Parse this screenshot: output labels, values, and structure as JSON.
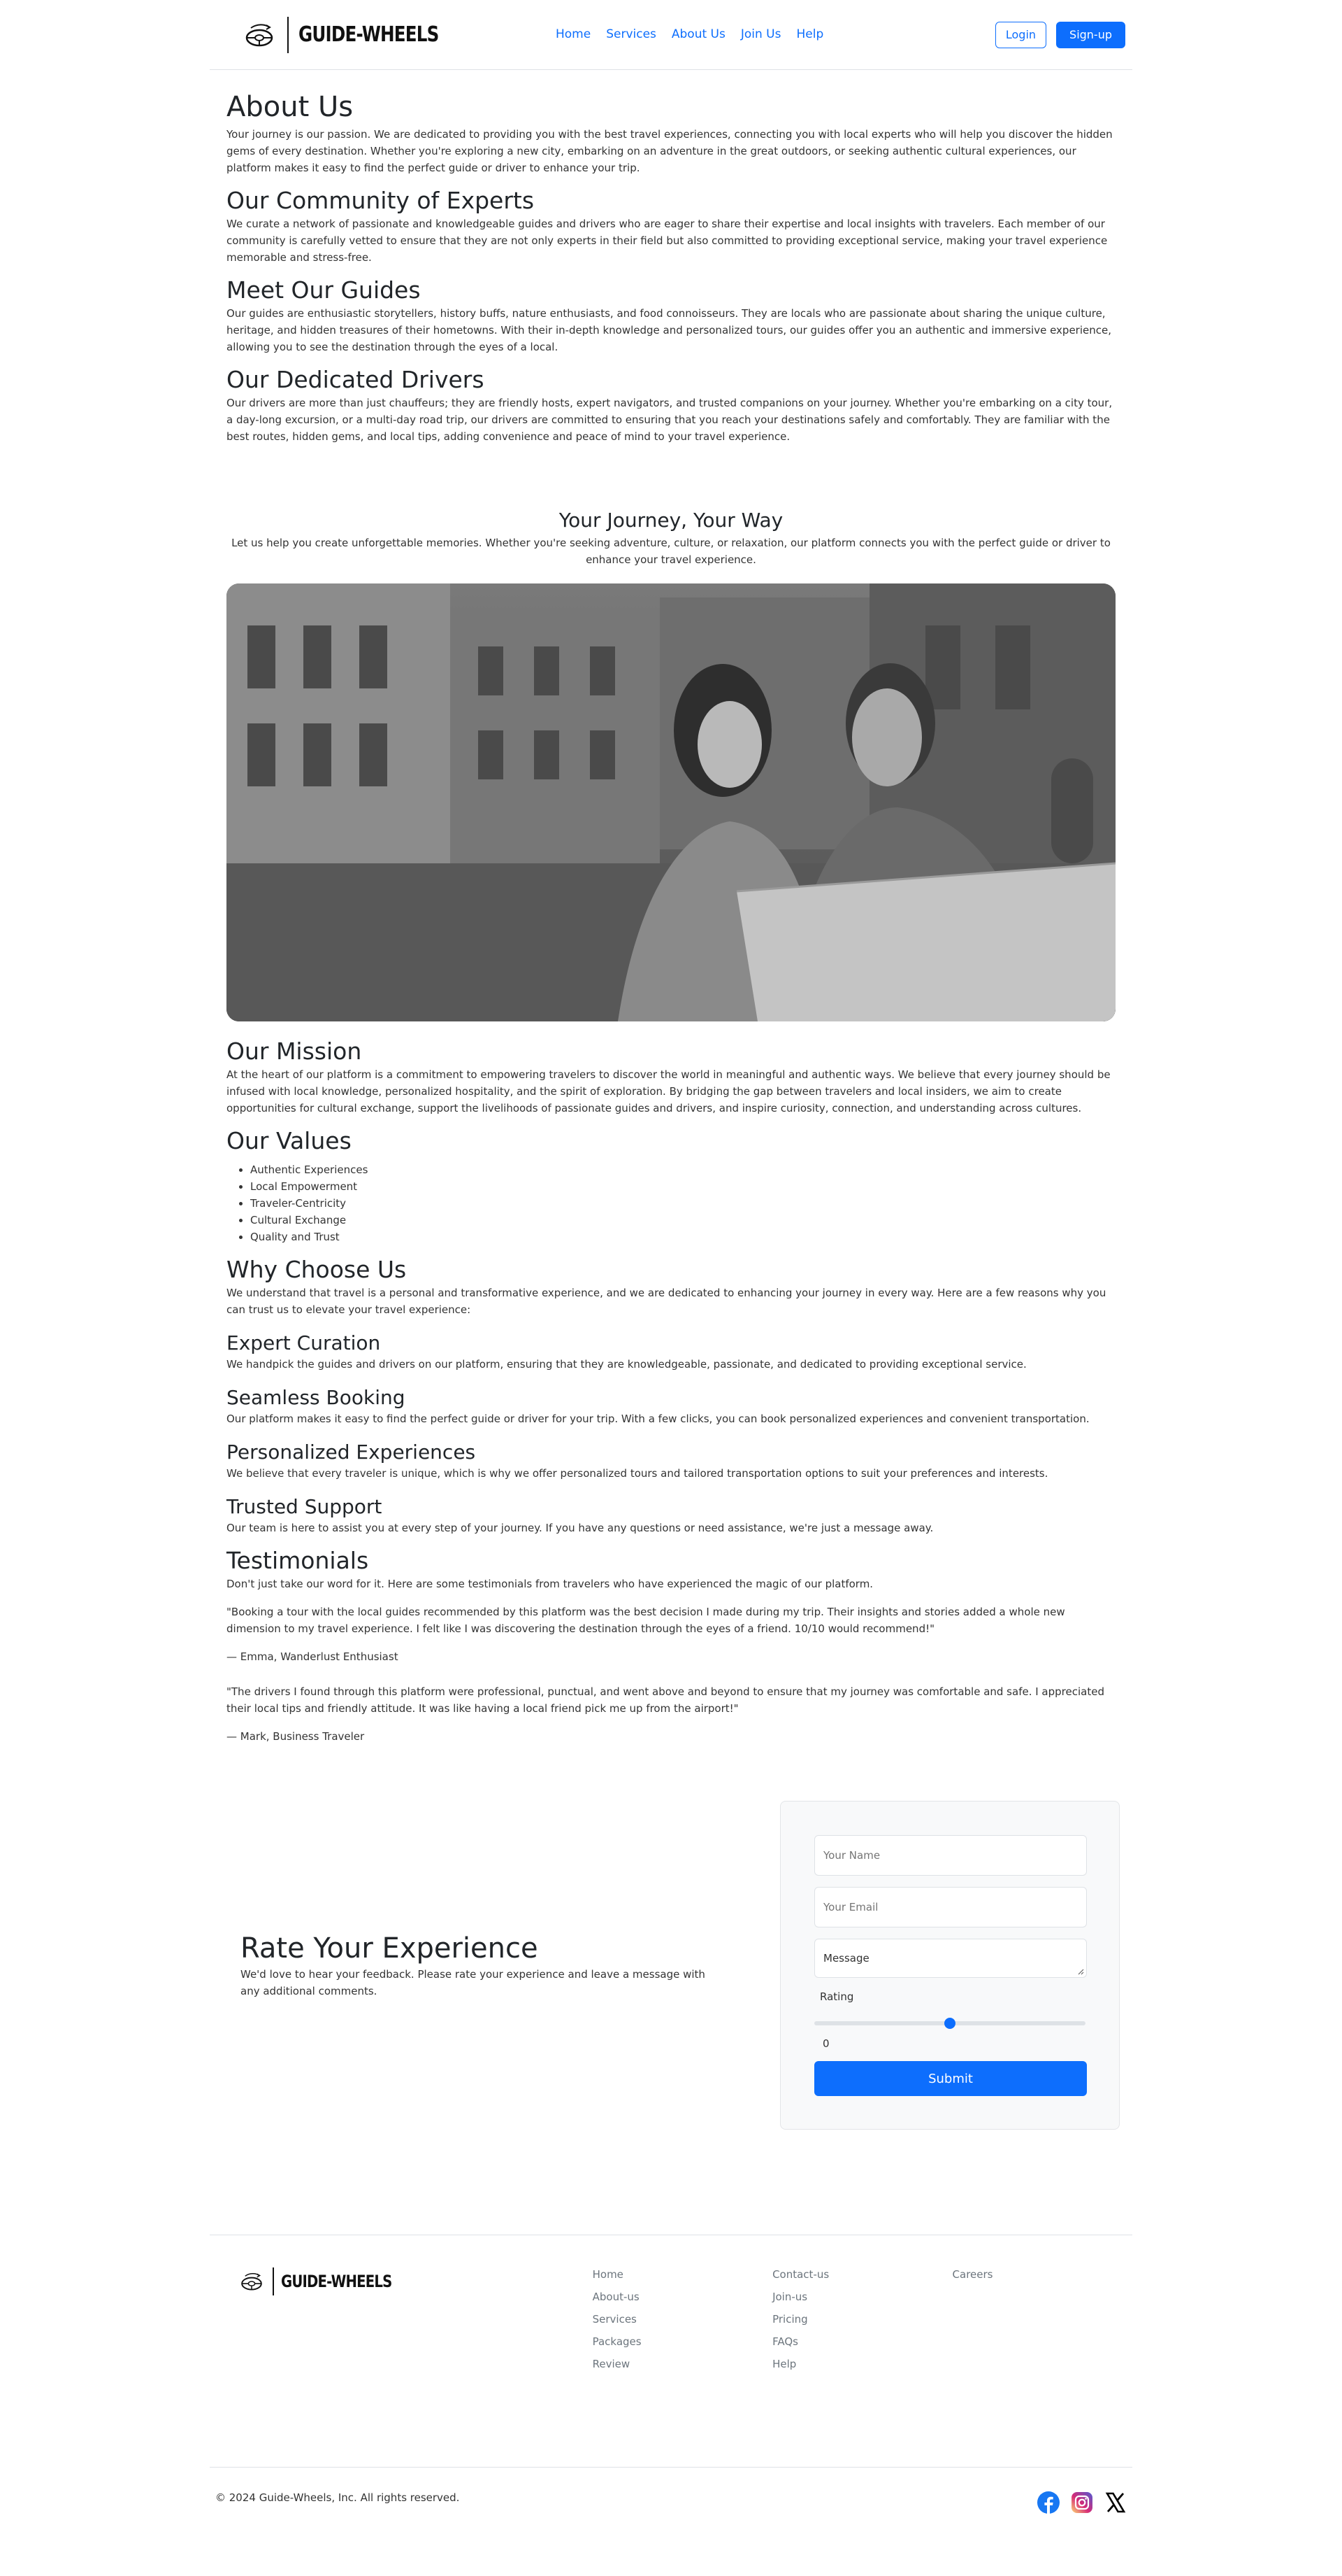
{
  "header": {
    "brand": "GUIDE-WHEELS",
    "nav": [
      "Home",
      "Services",
      "About Us",
      "Join Us",
      "Help"
    ],
    "login": "Login",
    "signup": "Sign-up"
  },
  "about": {
    "title": "About Us",
    "intro": "Your journey is our passion. We are dedicated to providing you with the best travel experiences, connecting you with local experts who will help you discover the hidden gems of every destination. Whether you're exploring a new city, embarking on an adventure in the great outdoors, or seeking authentic cultural experiences, our platform makes it easy to find the perfect guide or driver to enhance your trip.",
    "community_title": "Our Community of Experts",
    "community_text": "We curate a network of passionate and knowledgeable guides and drivers who are eager to share their expertise and local insights with travelers. Each member of our community is carefully vetted to ensure that they are not only experts in their field but also committed to providing exceptional service, making your travel experience memorable and stress-free.",
    "guides_title": "Meet Our Guides",
    "guides_text": "Our guides are enthusiastic storytellers, history buffs, nature enthusiasts, and food connoisseurs. They are locals who are passionate about sharing the unique culture, heritage, and hidden treasures of their hometowns. With their in-depth knowledge and personalized tours, our guides offer you an authentic and immersive experience, allowing you to see the destination through the eyes of a local.",
    "drivers_title": "Our Dedicated Drivers",
    "drivers_text": "Our drivers are more than just chauffeurs; they are friendly hosts, expert navigators, and trusted companions on your journey. Whether you're embarking on a city tour, a day-long excursion, or a multi-day road trip, our drivers are committed to ensuring that you reach your destinations safely and comfortably. They are familiar with the best routes, hidden gems, and local tips, adding convenience and peace of mind to your travel experience."
  },
  "journey": {
    "title": "Your Journey, Your Way",
    "text": "Let us help you create unforgettable memories. Whether you're seeking adventure, culture, or relaxation, our platform connects you with the perfect guide or driver to enhance your travel experience."
  },
  "mission": {
    "title": "Our Mission",
    "text": "At the heart of our platform is a commitment to empowering travelers to discover the world in meaningful and authentic ways. We believe that every journey should be infused with local knowledge, personalized hospitality, and the spirit of exploration. By bridging the gap between travelers and local insiders, we aim to create opportunities for cultural exchange, support the livelihoods of passionate guides and drivers, and inspire curiosity, connection, and understanding across cultures."
  },
  "values": {
    "title": "Our Values",
    "items": [
      "Authentic Experiences",
      "Local Empowerment",
      "Traveler-Centricity",
      "Cultural Exchange",
      "Quality and Trust"
    ]
  },
  "why": {
    "title": "Why Choose Us",
    "text": "We understand that travel is a personal and transformative experience, and we are dedicated to enhancing your journey in every way. Here are a few reasons why you can trust us to elevate your travel experience:",
    "curation_title": "Expert Curation",
    "curation_text": "We handpick the guides and drivers on our platform, ensuring that they are knowledgeable, passionate, and dedicated to providing exceptional service.",
    "booking_title": "Seamless Booking",
    "booking_text": "Our platform makes it easy to find the perfect guide or driver for your trip. With a few clicks, you can book personalized experiences and convenient transportation.",
    "personal_title": "Personalized Experiences",
    "personal_text": "We believe that every traveler is unique, which is why we offer personalized tours and tailored transportation options to suit your preferences and interests.",
    "support_title": "Trusted Support",
    "support_text": "Our team is here to assist you at every step of your journey. If you have any questions or need assistance, we're just a message away."
  },
  "testimonials": {
    "title": "Testimonials",
    "intro": "Don't just take our word for it. Here are some testimonials from travelers who have experienced the magic of our platform.",
    "quote1": "\"Booking a tour with the local guides recommended by this platform was the best decision I made during my trip. Their insights and stories added a whole new dimension to my travel experience. I felt like I was discovering the destination through the eyes of a friend. 10/10 would recommend!\"",
    "author1": "— Emma, Wanderlust Enthusiast",
    "quote2": "\"The drivers I found through this platform were professional, punctual, and went above and beyond to ensure that my journey was comfortable and safe. I appreciated their local tips and friendly attitude. It was like having a local friend pick me up from the airport!\"",
    "author2": "— Mark, Business Traveler"
  },
  "rate": {
    "title": "Rate Your Experience",
    "text": "We'd love to hear your feedback. Please rate your experience and leave a message with any additional comments.",
    "name_placeholder": "Your Name",
    "email_placeholder": "Your Email",
    "message_placeholder": "Message",
    "rating_label": "Rating",
    "rating_value": "0",
    "slider_fraction": 0.5,
    "submit": "Submit"
  },
  "footer": {
    "brand": "GUIDE-WHEELS",
    "col1": [
      "Home",
      "About-us",
      "Services",
      "Packages",
      "Review"
    ],
    "col2": [
      "Contact-us",
      "Join-us",
      "Pricing",
      "FAQs",
      "Help"
    ],
    "col3": [
      "Careers"
    ],
    "copyright": "© 2024 Guide-Wheels, Inc. All rights reserved."
  },
  "colors": {
    "accent": "#0d6efd",
    "facebook": "#1877f2",
    "instagram_start": "#feda75",
    "instagram_end": "#d62976"
  },
  "icons": [
    "steering-wheel-logo-icon",
    "facebook-icon",
    "instagram-icon",
    "x-icon"
  ]
}
